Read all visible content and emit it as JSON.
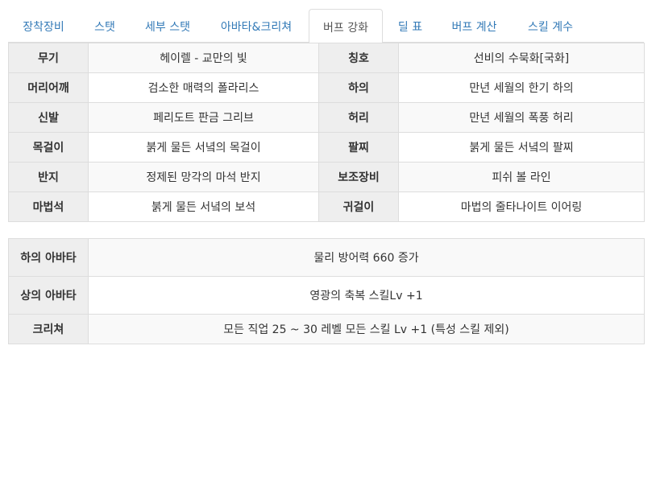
{
  "tabs": [
    {
      "label": "장착장비",
      "active": false
    },
    {
      "label": "스탯",
      "active": false
    },
    {
      "label": "세부 스탯",
      "active": false
    },
    {
      "label": "아바타&크리쳐",
      "active": false
    },
    {
      "label": "버프 강화",
      "active": true
    },
    {
      "label": "딜 표",
      "active": false
    },
    {
      "label": "버프 계산",
      "active": false
    },
    {
      "label": "스킬 계수",
      "active": false
    }
  ],
  "equipment": [
    {
      "slot1": "무기",
      "item1": "헤이렐 - 교만의 빛",
      "slot2": "칭호",
      "item2": "선비의 수묵화[국화]"
    },
    {
      "slot1": "머리어깨",
      "item1": "검소한 매력의 폴라리스",
      "slot2": "하의",
      "item2": "만년 세월의 한기 하의"
    },
    {
      "slot1": "신발",
      "item1": "페리도트 판금 그리브",
      "slot2": "허리",
      "item2": "만년 세월의 폭풍 허리"
    },
    {
      "slot1": "목걸이",
      "item1": "붉게 물든 서녘의 목걸이",
      "slot2": "팔찌",
      "item2": "붉게 물든 서녘의 팔찌"
    },
    {
      "slot1": "반지",
      "item1": "정제된 망각의 마석 반지",
      "slot2": "보조장비",
      "item2": "피쉬 볼 라인"
    },
    {
      "slot1": "마법석",
      "item1": "붉게 물든 서녘의 보석",
      "slot2": "귀걸이",
      "item2": "마법의 줄타나이트 이어링"
    }
  ],
  "avatars": [
    {
      "label": "하의 아바타",
      "value": "물리 방어력 660 증가"
    },
    {
      "label": "상의 아바타",
      "value": "영광의 축복 스킬Lv +1"
    },
    {
      "label": "크리쳐",
      "value": "모든 직업 25 ~ 30 레벨 모든 스킬 Lv +1 (특성 스킬 제외)"
    }
  ]
}
